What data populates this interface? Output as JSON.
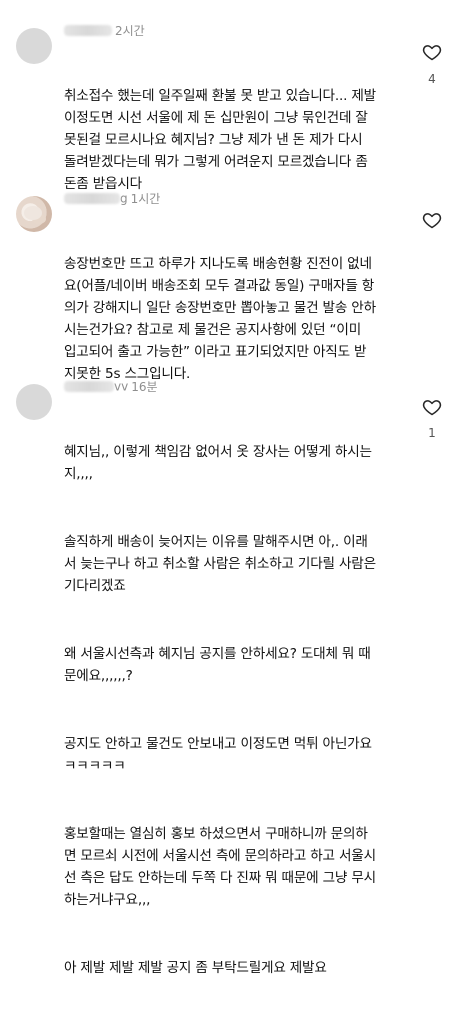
{
  "comments": [
    {
      "user_suffix": "",
      "time": "2시간",
      "like_count": "4",
      "paragraphs": [
        "취소접수 했는데 일주일째 환불 못 받고 있습니다... 제발\n이정도면 시선 서울에 제 돈 십만원이 그냥 묶인건데 잘\n못된걸 모르시나요 혜지님? 그냥 제가 낸 돈 제가 다시\n돌려받겠다는데 뭐가 그렇게 어려운지 모르겠습니다 좀\n돈좀 받읍시다"
      ]
    },
    {
      "user_suffix": "g",
      "time": "1시간",
      "like_count": "",
      "paragraphs": [
        "송장번호만 뜨고 하루가 지나도록 배송현황 진전이 없네\n요(어플/네이버 배송조회 모두 결과값 동일) 구매자들 항\n의가 강해지니 일단 송장번호만 뽑아놓고 물건 발송 안하\n시는건가요? 참고로 제 물건은 공지사항에 있던 “이미\n입고되어 출고 가능한” 이라고 표기되었지만 아직도 받\n지못한 5s 스그입니다."
      ]
    },
    {
      "user_suffix": "vv",
      "time": "16분",
      "like_count": "1",
      "paragraphs": [
        "혜지님,, 이렇게 책임감 없어서 옷 장사는 어떻게 하시는\n지,,,,",
        "솔직하게 배송이 늦어지는 이유를 말해주시면 아,. 이래\n서 늦는구나 하고 취소할 사람은 취소하고 기다릴 사람은\n기다리겠죠",
        "왜 서울시선측과 혜지님 공지를 안하세요? 도대체 뭐 때\n문에요,,,,,,?",
        "공지도 안하고 물건도 안보내고 이정도면 먹튀 아닌가요\nㅋㅋㅋㅋㅋ",
        "홍보할때는 열심히 홍보 하셨으면서 구매하니까 문의하\n면 모르쇠 시전에 서울시선 측에 문의하라고 하고 서울시\n선 측은 답도 안하는데 두쪽 다 진짜 뭐 때문에 그냥 무시\n하는거냐구요,,,",
        "아 제발 제발 제발 공지 좀 부탁드릴게요 제발요"
      ]
    }
  ],
  "icons": {
    "like": "heart-outline-icon",
    "avatar": "profile-avatar"
  },
  "colors": {
    "meta": "#8e8e8e",
    "text": "#111111",
    "icon": "#262626"
  }
}
